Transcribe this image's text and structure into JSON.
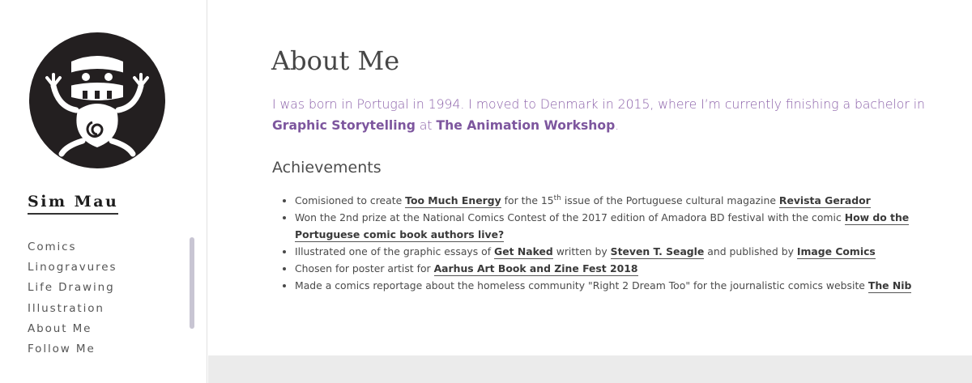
{
  "sidebar": {
    "site_title": "Sim Mau",
    "nav": [
      "Comics",
      "Linogravures",
      "Life Drawing",
      "Illustration",
      "About Me",
      "Follow Me"
    ]
  },
  "main": {
    "title": "About Me",
    "intro": {
      "text1": "I was born in Portugal in 1994. I moved to Denmark in 2015, where I’m currently finishing a bachelor in ",
      "link1": "Graphic Storytelling",
      "text2": " at ",
      "link2": "The Animation Workshop",
      "text3": "."
    },
    "achievements_title": "Achievements",
    "achievements": [
      {
        "t1": "Comisioned to create ",
        "l1": "Too Much Energy",
        "t2": " for the 15",
        "sup": "th",
        "t3": " issue of the Portuguese cultural magazine ",
        "l2": "Revista Gerador"
      },
      {
        "t1": "Won the 2nd prize at the National Comics Contest of the 2017 edition of Amadora BD festival with the comic ",
        "l1": "How do the Portuguese comic book authors live?"
      },
      {
        "t1": "Illustrated one of the graphic essays of ",
        "l1": "Get Naked",
        "t2": " written by ",
        "l2": "Steven T. Seagle",
        "t3": " and published by ",
        "l3": "Image Comics"
      },
      {
        "t1": "Chosen for poster artist for ",
        "l1": "Aarhus Art Book and Zine Fest 2018"
      },
      {
        "t1": "Made a comics reportage about the homeless community \"Right 2 Dream Too\" for the journalistic comics website ",
        "l1": "The Nib"
      }
    ]
  },
  "colors": {
    "accent": "#8a5fa8",
    "text": "#4a4a4a",
    "scrollbar": "#c8c5d3",
    "footer_band": "#ebebeb"
  },
  "icons": {
    "logo": "masked-figure-logo-icon"
  }
}
